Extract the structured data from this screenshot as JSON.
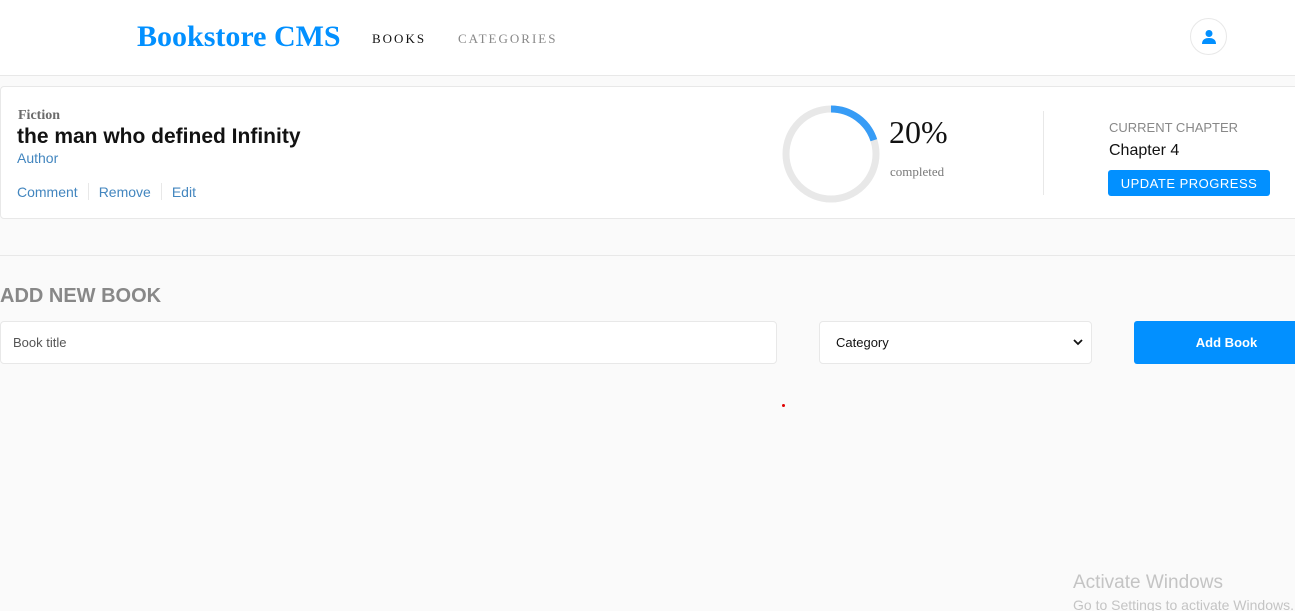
{
  "header": {
    "brand": "Bookstore CMS",
    "nav": [
      {
        "label": "BOOKS",
        "active": true
      },
      {
        "label": "CATEGORIES",
        "active": false
      }
    ],
    "user_icon": "user-icon"
  },
  "book": {
    "genre": "Fiction",
    "title": "the man who defined Infinity",
    "author": "Author",
    "actions": [
      "Comment",
      "Remove",
      "Edit"
    ],
    "progress": {
      "percent_value": 20,
      "percent_label": "20%",
      "completed_label": "completed"
    },
    "chapter": {
      "label": "CURRENT CHAPTER",
      "value": "Chapter 4",
      "button_label": "UPDATE PROGRESS"
    }
  },
  "form": {
    "title": "ADD NEW BOOK",
    "title_placeholder": "Book title",
    "category_selected": "Category",
    "submit_label": "Add Book"
  },
  "watermark": {
    "title": "Activate Windows",
    "subtitle": "Go to Settings to activate Windows."
  },
  "colors": {
    "accent": "#0290ff",
    "progress_arc": "#379cf6",
    "progress_track": "#e8e8e8",
    "link": "#4386bf"
  }
}
